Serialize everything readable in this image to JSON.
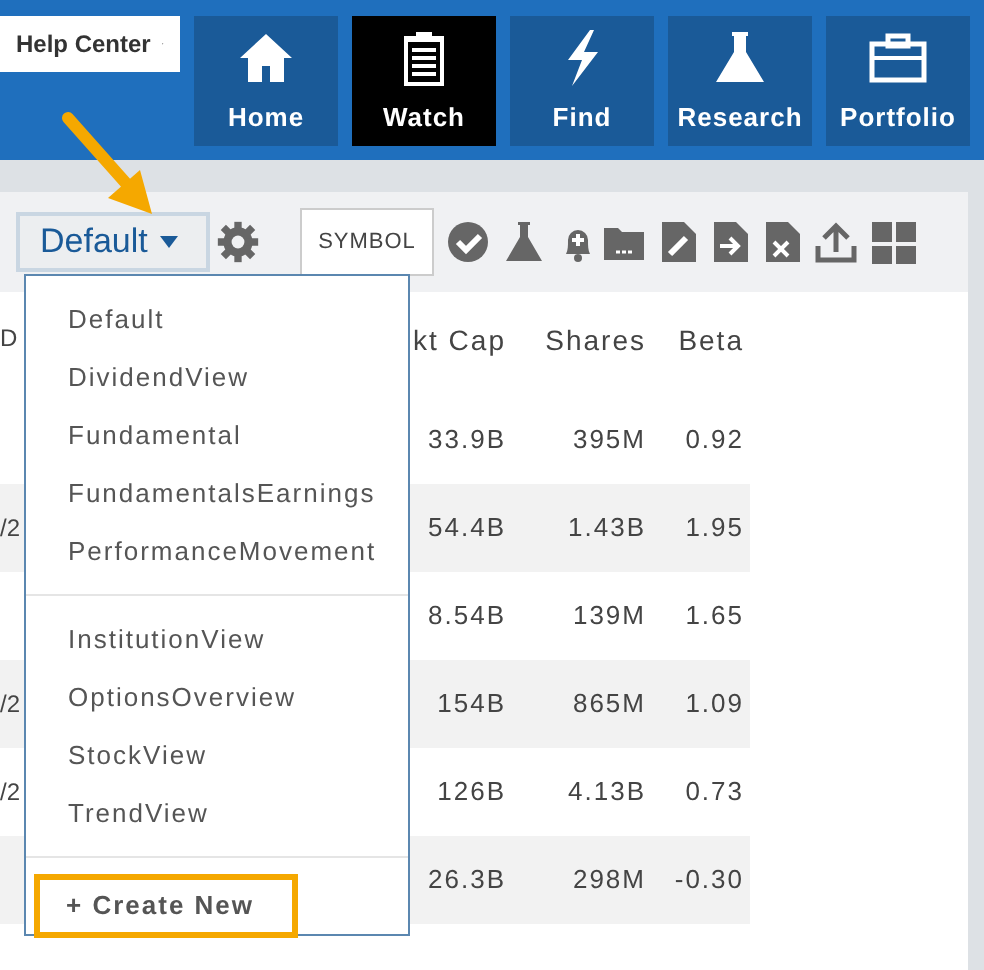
{
  "help_menu": {
    "label": "Help Center"
  },
  "nav": [
    {
      "label": "Home",
      "selected": false
    },
    {
      "label": "Watch",
      "selected": true
    },
    {
      "label": "Find",
      "selected": false
    },
    {
      "label": "Research",
      "selected": false
    },
    {
      "label": "Portfolio",
      "selected": false
    }
  ],
  "view_selector": {
    "label": "Default",
    "expanded": true
  },
  "symbol_field": {
    "placeholder": "SYMBOL"
  },
  "view_menu": {
    "groups": [
      [
        "Default",
        "DividendView",
        "Fundamental",
        "FundamentalsEarnings",
        "PerformanceMovement"
      ],
      [
        "InstitutionView",
        "OptionsOverview",
        "StockView",
        "TrendView"
      ]
    ],
    "create_button": "+ Create New"
  },
  "table": {
    "columns": {
      "column_1": "D",
      "mkt_cap": "kt Cap",
      "shares": "Shares",
      "beta": "Beta"
    },
    "rows": [
      {
        "mkt_cap": "33.9B",
        "shares": "395M",
        "beta": "0.92"
      },
      {
        "column_1": "/2",
        "mkt_cap": "54.4B",
        "shares": "1.43B",
        "beta": "1.95"
      },
      {
        "mkt_cap": "8.54B",
        "shares": "139M",
        "beta": "1.65"
      },
      {
        "column_1": "/2",
        "mkt_cap": "154B",
        "shares": "865M",
        "beta": "1.09"
      },
      {
        "column_1": "/2",
        "mkt_cap": "126B",
        "shares": "4.13B",
        "beta": "0.73"
      },
      {
        "mkt_cap": "26.3B",
        "shares": "298M",
        "beta": "-0.30"
      }
    ]
  }
}
